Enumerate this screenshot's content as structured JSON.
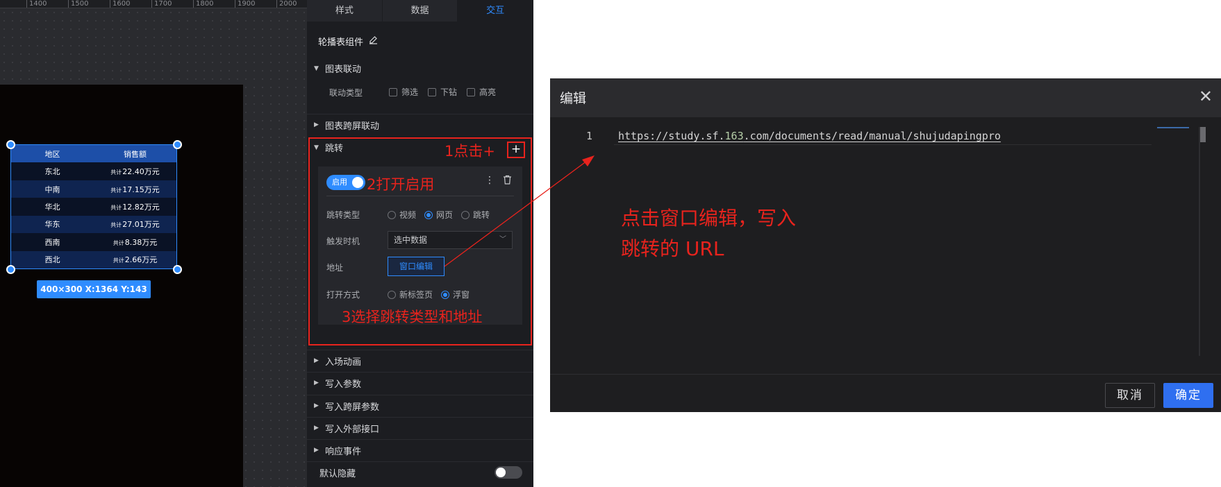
{
  "ruler": {
    "ticks": [
      "1400",
      "1500",
      "1600",
      "1700",
      "1800",
      "1900",
      "2000"
    ]
  },
  "widget": {
    "headers": [
      "地区",
      "销售额"
    ],
    "prefix": "共计",
    "rows": [
      {
        "region": "东北",
        "value": "22.40万元"
      },
      {
        "region": "中南",
        "value": "17.15万元"
      },
      {
        "region": "华北",
        "value": "12.82万元"
      },
      {
        "region": "华东",
        "value": "27.01万元"
      },
      {
        "region": "西南",
        "value": "8.38万元"
      },
      {
        "region": "西北",
        "value": "2.66万元"
      }
    ],
    "size_badge": "400×300   X:1364 Y:143"
  },
  "panel": {
    "tabs": [
      "样式",
      "数据",
      "交互"
    ],
    "component_title": "轮播表组件",
    "sections": {
      "chart_link": "图表联动",
      "link_type_label": "联动类型",
      "link_options": [
        "筛选",
        "下钻",
        "高亮"
      ],
      "cross_screen_link": "图表跨屏联动",
      "jump": "跳转",
      "entry_animation": "入场动画",
      "write_params": "写入参数",
      "write_cross_params": "写入跨屏参数",
      "write_external": "写入外部接口",
      "respond_event": "响应事件",
      "default_hidden": "默认隐藏"
    },
    "jump_card": {
      "enable_label": "启用",
      "jump_type_label": "跳转类型",
      "jump_type_options": [
        "视频",
        "网页",
        "跳转"
      ],
      "trigger_label": "触发时机",
      "trigger_value": "选中数据",
      "address_label": "地址",
      "address_button": "窗口编辑",
      "open_mode_label": "打开方式",
      "open_mode_options": [
        "新标签页",
        "浮窗"
      ]
    },
    "annotations": {
      "step1": "1点击+",
      "step2": "2打开启用",
      "step3": "3选择跳转类型和地址"
    }
  },
  "dialog": {
    "title": "编辑",
    "line_number": "1",
    "url_before": "https://study.sf.",
    "url_number": "163",
    "url_after": ".com/documents/read/manual/shujudapingpro",
    "annotation_line1": "点击窗口编辑，写入",
    "annotation_line2": "跳转的 URL",
    "cancel": "取消",
    "confirm": "确定"
  },
  "colors": {
    "accent": "#2f8cff",
    "annotation_red": "#e8231d",
    "panel_bg": "#1c1d21",
    "dialog_bg": "#1e1e20"
  }
}
